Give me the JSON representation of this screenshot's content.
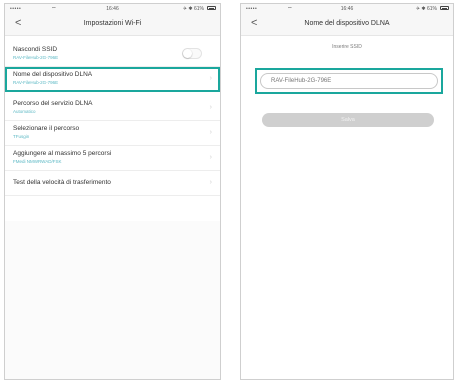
{
  "left_screen": {
    "status_bar": {
      "carrier": "•••••",
      "wifi_icon": "wifi-icon",
      "time": "16:46",
      "right": "✈ ✱ 61%"
    },
    "nav": {
      "back": "<",
      "title": "Impostazioni Wi-Fi"
    },
    "rows": [
      {
        "label": "Nascondi SSID",
        "sub": "RAV-FileHub-2G-796E"
      },
      {
        "label": "Nome del dispositivo DLNA",
        "sub": "RAV-FileHub-2G-796E"
      },
      {
        "label": "Percorso del servizio DLNA",
        "sub": "Automatico"
      },
      {
        "label": "Selezionare il percorso",
        "sub": "TFusgin"
      },
      {
        "label": "Aggiungere al massimo 5 percorsi",
        "sub": "FMedi NMWRWAD/FSK"
      },
      {
        "label": "Test della velocità di trasferimento",
        "sub": ""
      }
    ]
  },
  "right_screen": {
    "status_bar": {
      "carrier": "•••••",
      "wifi_icon": "wifi-icon",
      "time": "16:46",
      "right": "✈ ✱ 61%"
    },
    "nav": {
      "back": "<",
      "title": "Nome del dispositivo DLNA"
    },
    "field_caption": "Inserire SSID",
    "device_name_value": "RAV-FileHub-2G-796E",
    "save_label": "Salva"
  },
  "colors": {
    "highlight": "#1aa79d",
    "subtitle": "#5bb8c4",
    "button_disabled": "#cfcfcf"
  }
}
